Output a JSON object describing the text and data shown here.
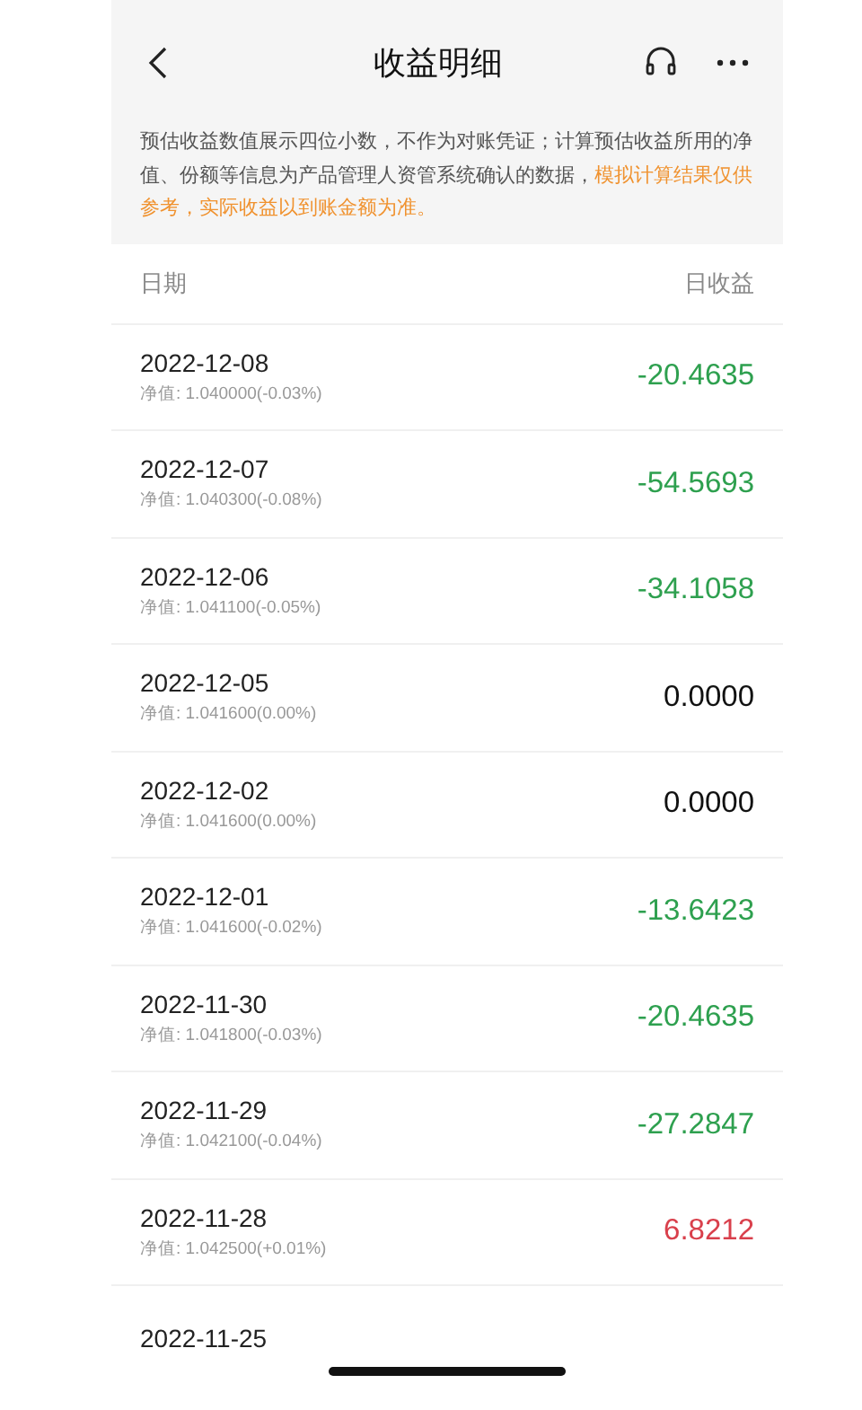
{
  "header": {
    "title": "收益明细"
  },
  "notice": {
    "text": "预估收益数值展示四位小数，不作为对账凭证；计算预估收益所用的净值、份额等信息为产品管理人资管系统确认的数据，",
    "highlight": "模拟计算结果仅供参考，实际收益以到账金额为准。"
  },
  "columns": [
    "日期",
    "日收益"
  ],
  "rows": [
    {
      "date": "2022-12-08",
      "nav": "净值: 1.040000(-0.03%)",
      "amount": "-20.4635",
      "color": "#2ea04f"
    },
    {
      "date": "2022-12-07",
      "nav": "净值: 1.040300(-0.08%)",
      "amount": "-54.5693",
      "color": "#2ea04f"
    },
    {
      "date": "2022-12-06",
      "nav": "净值: 1.041100(-0.05%)",
      "amount": "-34.1058",
      "color": "#2ea04f"
    },
    {
      "date": "2022-12-05",
      "nav": "净值: 1.041600(0.00%)",
      "amount": "0.0000",
      "color": "#111111"
    },
    {
      "date": "2022-12-02",
      "nav": "净值: 1.041600(0.00%)",
      "amount": "0.0000",
      "color": "#111111"
    },
    {
      "date": "2022-12-01",
      "nav": "净值: 1.041600(-0.02%)",
      "amount": "-13.6423",
      "color": "#2ea04f"
    },
    {
      "date": "2022-11-30",
      "nav": "净值: 1.041800(-0.03%)",
      "amount": "-20.4635",
      "color": "#2ea04f"
    },
    {
      "date": "2022-11-29",
      "nav": "净值: 1.042100(-0.04%)",
      "amount": "-27.2847",
      "color": "#2ea04f"
    },
    {
      "date": "2022-11-28",
      "nav": "净值: 1.042500(+0.01%)",
      "amount": "6.8212",
      "color": "#d9404c"
    },
    {
      "date": "2022-11-25"
    }
  ]
}
